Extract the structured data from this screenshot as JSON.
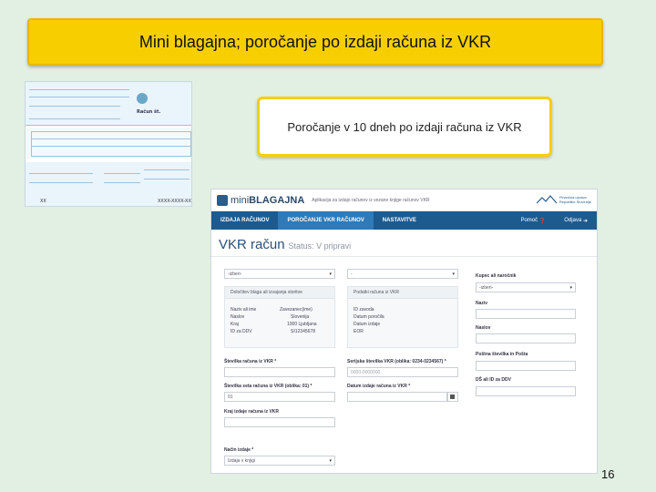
{
  "slide": {
    "title": "Mini blagajna; poročanje po izdaji računa iz VKR",
    "subtitle": "Poročanje v 10 dneh po izdaji računa iz VKR",
    "page_number": "16"
  },
  "invoice": {
    "heading": "Račun št.",
    "code_left": "XX",
    "code_right": "XXXX-XXXX-XX"
  },
  "app": {
    "logo_prefix": "mini",
    "logo_main": "BLAGAJNA",
    "subtitle": "Aplikacija za izdajo računov iz vezane knjige računov VKR",
    "agency": [
      "Finančna uprava",
      "Republike Slovenije"
    ],
    "nav": {
      "items": [
        "IZDAJA RAČUNOV",
        "POROČANJE VKR RAČUNOV",
        "NASTAVITVE"
      ],
      "active": "POROČANJE VKR RAČUNOV",
      "help": "Pomoč",
      "logout": "Odjava"
    },
    "page_title": "VKR račun",
    "page_status": "Status: V pripravi",
    "select_left": "-izberi-",
    "select_mid": "-",
    "left_panel": {
      "header": "Določitev blaga ali izvajanja storitve",
      "rows": [
        [
          "Naziv ali ime",
          "Zavezanec(ime)"
        ],
        [
          "Naslov",
          "Slovenija"
        ],
        [
          "Kraj",
          "1000 Ljubljana"
        ],
        [
          "ID za DDV",
          "SI12345678"
        ]
      ]
    },
    "right_panel": {
      "header": "Podatki računa iz VKR",
      "rows": [
        "ID zavoda",
        "Datum poročila",
        "Datum izdaje",
        "EOR"
      ]
    },
    "buyer": {
      "label": "Kupec ali naročnik",
      "select": "-izberi-",
      "name_label": "Naziv",
      "address_label": "Naslov",
      "postal_label": "Poštna številka in Pošta",
      "tax_label": "DŠ ali ID za DDV"
    },
    "fields": {
      "invoice_no_label": "Številka računa iz VKR *",
      "serial_label": "Serijska številka VKR (oblika: 0234-0234567) *",
      "serial_placeholder": "0000-0000000",
      "set_no_label": "Številka seta računa iz VKR (oblika: 01) *",
      "set_no_value": "01",
      "date_label": "Datum izdaje računa iz VKR *",
      "place_label": "Kraj izdaje računa iz VKR",
      "method_label": "Način izdaje *",
      "method_value": "Izdaja v knjigi"
    }
  }
}
